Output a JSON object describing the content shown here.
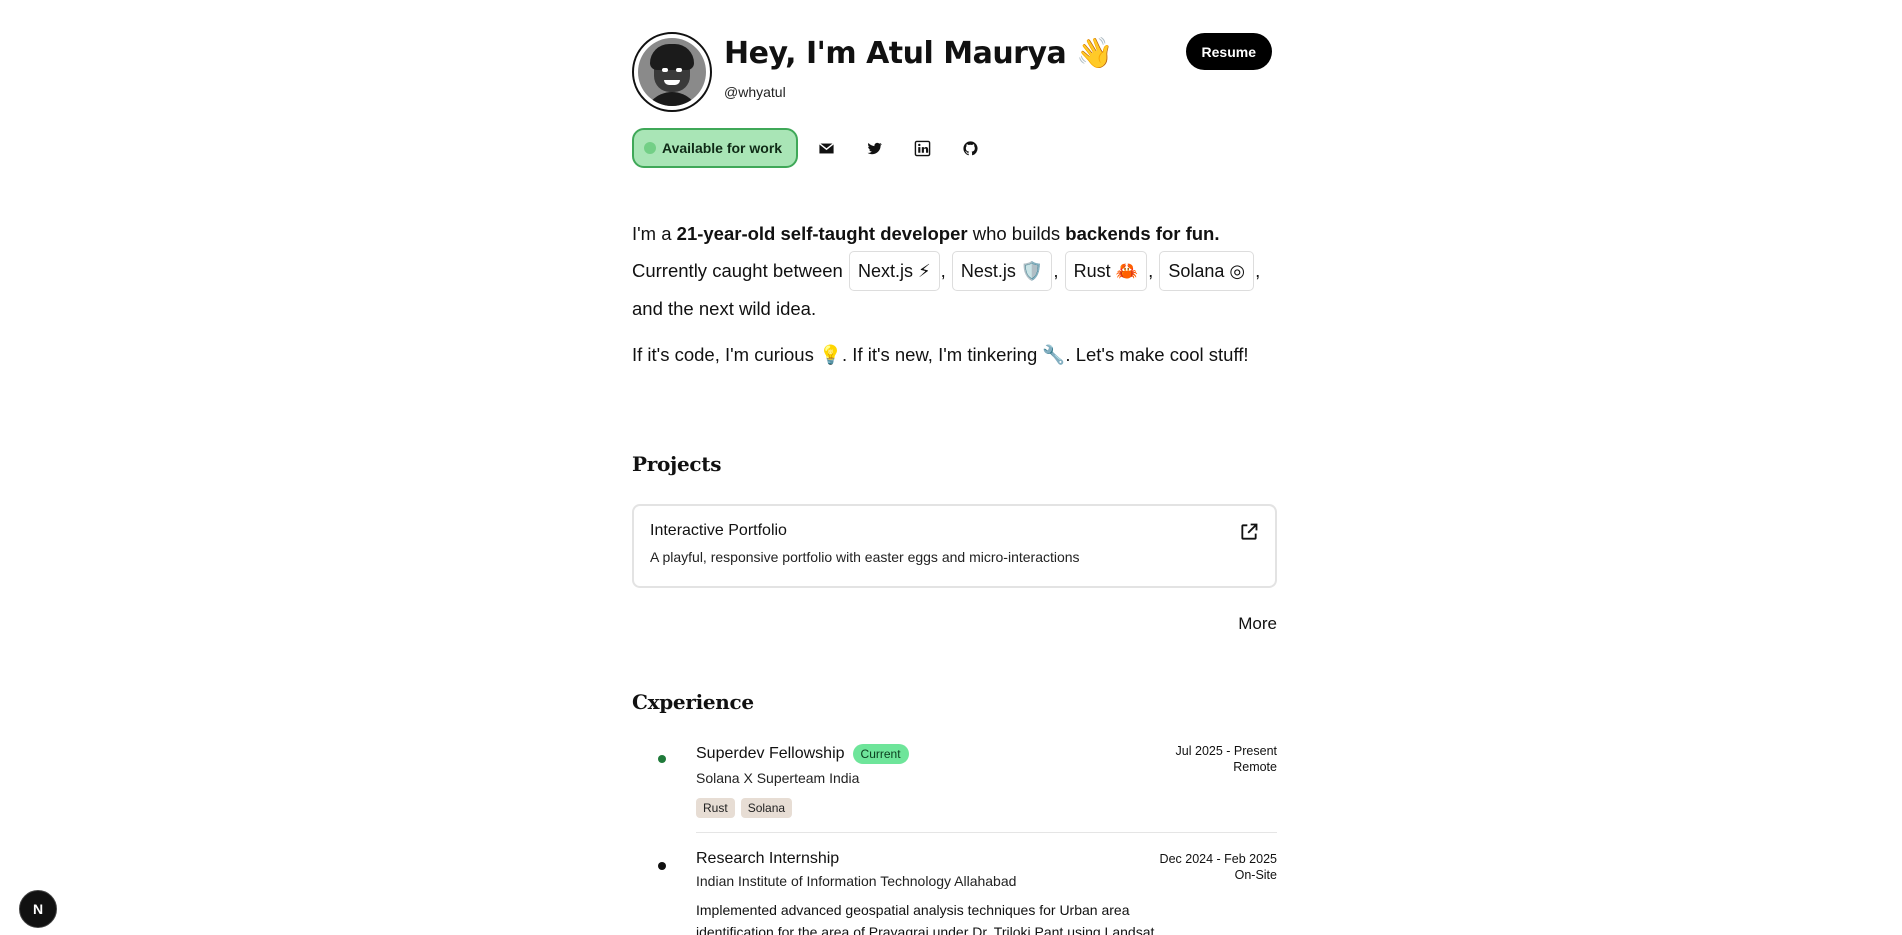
{
  "header": {
    "title": "Hey, I'm Atul Maurya 👋",
    "handle": "@whyatul",
    "resume_label": "Resume"
  },
  "status": {
    "available_label": "Available for work",
    "social_icons": [
      "mail-icon",
      "twitter-icon",
      "linkedin-icon",
      "github-icon"
    ]
  },
  "intro": {
    "p1_a": "I'm a ",
    "p1_b": "21-year-old self-taught developer",
    "p1_c": " who builds ",
    "p1_d": "backends for fun.",
    "p1_e": "Currently caught between ",
    "chips": [
      "Next.js ⚡",
      "Nest.js 🛡️",
      "Rust 🦀",
      "Solana ◎"
    ],
    "sep": ",",
    "p1_f": "and the next wild idea.",
    "p2": "If it's code, I'm curious 💡. If it's new, I'm tinkering 🔧. Let's make cool stuff!"
  },
  "projects": {
    "heading": "Projects",
    "items": [
      {
        "name": "Interactive Portfolio",
        "description": "A playful, responsive portfolio with easter eggs and micro-interactions"
      }
    ],
    "more_label": "More"
  },
  "experience": {
    "heading": "Cxperience",
    "items": [
      {
        "role": "Superdev Fellowship",
        "badge": "Current",
        "org": "Solana X Superteam India",
        "dates": "Jul 2025 - Present",
        "location": "Remote",
        "tags": [
          "Rust",
          "Solana"
        ],
        "bullet_color": "#1f7a3a"
      },
      {
        "role": "Research Internship",
        "org": "Indian Institute of Information Technology Allahabad",
        "dates": "Dec 2024 - Feb 2025",
        "location": "On-Site",
        "description": "Implemented advanced geospatial analysis techniques for Urban area identification for the area of Prayagraj under Dr. Triloki Pant using Landsat",
        "bullet_color": "#111111"
      }
    ]
  },
  "floating": {
    "label": "N"
  }
}
